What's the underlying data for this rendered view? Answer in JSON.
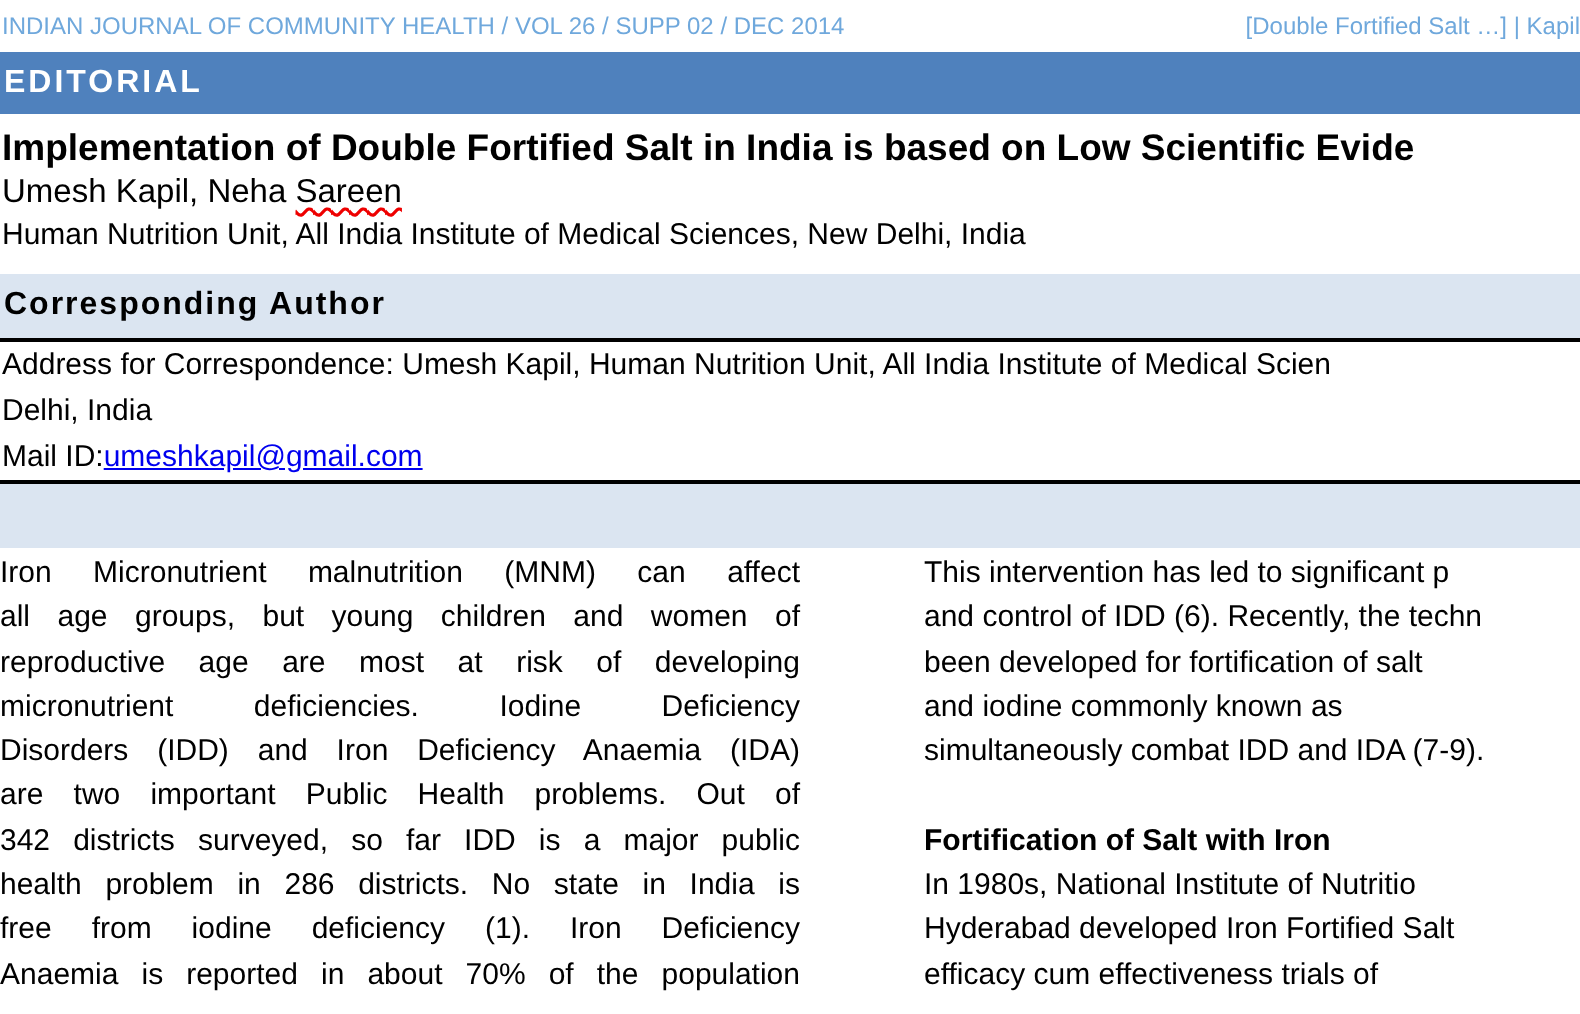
{
  "header": {
    "journal": "INDIAN JOURNAL OF COMMUNITY HEALTH / VOL 26 / SUPP 02 / DEC 2014",
    "running_title": "[Double Fortified Salt …] | Kapil"
  },
  "section_banner": "EDITORIAL",
  "article": {
    "title": "Implementation of Double Fortified Salt in India is based on Low Scientific Evide",
    "authors": [
      {
        "text": "Umesh Kapil, Neha",
        "flagged": false
      },
      {
        "text": "Sareen",
        "flagged": true
      }
    ],
    "affiliation": "Human Nutrition Unit, All India Institute of Medical Sciences, New Delhi, India"
  },
  "correspondence": {
    "heading": "Corresponding Author",
    "address_lines": [
      "Address for Correspondence: Umesh Kapil, Human Nutrition Unit, All India Institute of Medical Scien",
      "Delhi, India"
    ],
    "mail_label": "Mail ID:",
    "email": "umeshkapil@gmail.com"
  },
  "body": {
    "left_lines": [
      "Iron Micronutrient malnutrition (MNM) can affect",
      "all age groups, but young children and women of",
      "reproductive age are most at risk of developing",
      "micronutrient deficiencies. Iodine Deficiency",
      "Disorders (IDD) and Iron Deficiency Anaemia (IDA)",
      "are two important Public Health problems. Out of",
      "342 districts surveyed, so far IDD is a major public",
      "health problem in 286 districts. No state in India is",
      "free from iodine deficiency (1). Iron Deficiency",
      "Anaemia is reported in about 70% of the population"
    ],
    "right_lines": [
      {
        "kind": "text",
        "text": "This intervention has led to significant p"
      },
      {
        "kind": "text",
        "text": "and control of IDD (6). Recently, the techn"
      },
      {
        "kind": "text",
        "text": "been developed for fortification of salt"
      },
      {
        "kind": "text",
        "text": "and iodine commonly known as"
      },
      {
        "kind": "text",
        "text": "simultaneously combat IDD and IDA (7-9)."
      },
      {
        "kind": "gap"
      },
      {
        "kind": "heading",
        "text": "Fortification of Salt with Iron"
      },
      {
        "kind": "text",
        "text": "In 1980s, National Institute of Nutritio"
      },
      {
        "kind": "text",
        "text": "Hyderabad developed Iron Fortified Salt"
      },
      {
        "kind": "text",
        "text": "efficacy cum effectiveness trials of"
      }
    ]
  }
}
